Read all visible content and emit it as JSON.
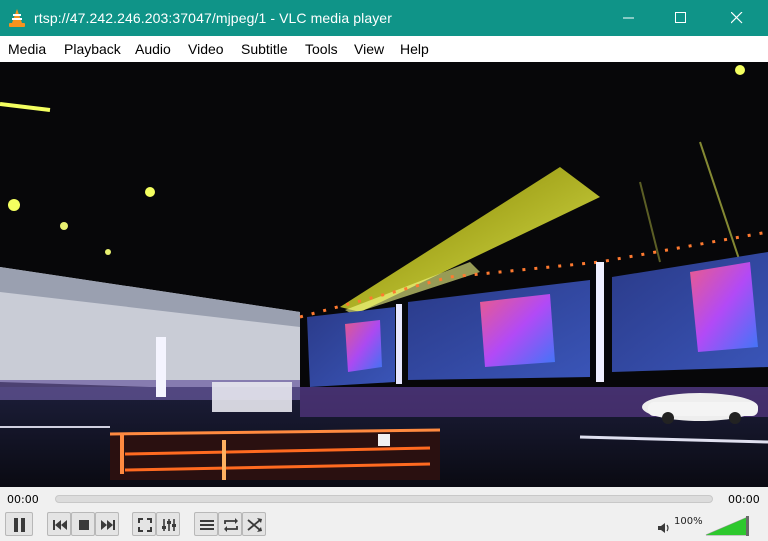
{
  "window": {
    "title": "rtsp://47.242.246.203:37047/mjpeg/1 - VLC media player",
    "titlebar_color": "#0f9488"
  },
  "menu": {
    "items": [
      "Media",
      "Playback",
      "Audio",
      "Video",
      "Subtitle",
      "Tools",
      "View",
      "Help"
    ]
  },
  "playback": {
    "elapsed": "00:00",
    "total": "00:00",
    "progress": 0
  },
  "controls": {
    "buttons": [
      {
        "name": "pause-button",
        "icon": "pause-icon"
      },
      {
        "name": "previous-button",
        "icon": "skip-back-icon"
      },
      {
        "name": "stop-button",
        "icon": "stop-icon"
      },
      {
        "name": "next-button",
        "icon": "skip-forward-icon"
      },
      {
        "name": "fullscreen-button",
        "icon": "fullscreen-icon"
      },
      {
        "name": "extended-settings-button",
        "icon": "equalizer-icon"
      },
      {
        "name": "playlist-button",
        "icon": "playlist-icon"
      },
      {
        "name": "loop-button",
        "icon": "loop-icon"
      },
      {
        "name": "shuffle-button",
        "icon": "shuffle-icon"
      }
    ]
  },
  "volume": {
    "label": "100%",
    "level": 1.0,
    "color": "#2ec82e"
  }
}
